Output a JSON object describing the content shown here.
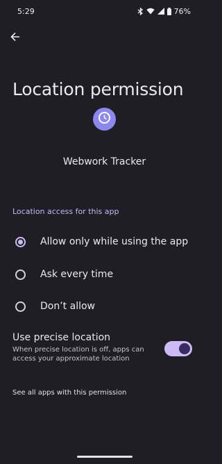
{
  "status_bar": {
    "time": "5:29",
    "battery": "76%",
    "icons": [
      "bluetooth-icon",
      "wifi-icon",
      "signal-icon",
      "battery-icon"
    ]
  },
  "header": {
    "back_icon": "arrow-back-icon",
    "title": "Location permission"
  },
  "app": {
    "icon": "clock-icon",
    "name": "Webwork Tracker"
  },
  "section": {
    "label": "Location access for this app"
  },
  "options": [
    {
      "label": "Allow only while using the app",
      "selected": true
    },
    {
      "label": "Ask every time",
      "selected": false
    },
    {
      "label": "Don’t allow",
      "selected": false
    }
  ],
  "precise": {
    "title": "Use precise location",
    "description": "When precise location is off, apps can access your approximate location",
    "enabled": true
  },
  "footer": {
    "see_all": "See all apps with this permission"
  },
  "colors": {
    "background": "#1f1e24",
    "accent": "#cdbbf5",
    "app_icon": "#8d88f0"
  }
}
